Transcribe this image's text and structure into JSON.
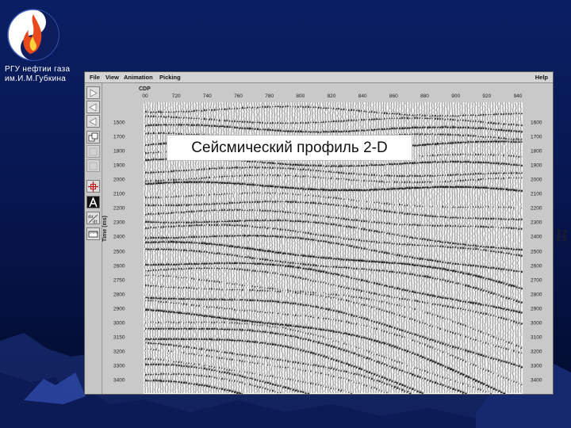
{
  "slide": {
    "org_line1": "РГУ нефтии газа",
    "org_line2": "им.И.М.Губкина",
    "title": "Сейсмический профиль 2-D",
    "colors": {
      "background_top": "#0a1f63",
      "background_bottom": "#020a28",
      "logo_flame": "#e8491d",
      "logo_bg": "#ffffff"
    }
  },
  "window": {
    "menu": {
      "file": "File",
      "view": "View",
      "animation": "Animation",
      "picking": "Picking",
      "help": "Help"
    },
    "tools": [
      {
        "icon": "play-forward-icon"
      },
      {
        "icon": "step-back-icon"
      },
      {
        "icon": "step-back-icon"
      },
      {
        "icon": "duplicate-window-icon"
      },
      {
        "icon": "disabled-tool-icon"
      },
      {
        "icon": "disabled-tool-icon"
      },
      {
        "icon": "zoom-crosshair-icon"
      },
      {
        "icon": "annotation-A-icon"
      },
      {
        "icon": "dx-dt-icon"
      },
      {
        "icon": "ruler-icon"
      }
    ],
    "plot": {
      "x_axis_label": "CDP",
      "y_axis_label": "Time (ms)",
      "x_ticks": [
        "00",
        "720",
        "740",
        "760",
        "780",
        "800",
        "820",
        "840",
        "860",
        "880",
        "900",
        "920",
        "940"
      ],
      "y_ticks_left": [
        "1500",
        "1700",
        "1800",
        "1900",
        "2000",
        "2100",
        "2200",
        "2300",
        "2400",
        "2500",
        "2600",
        "2750",
        "2800",
        "2900",
        "3000",
        "3150",
        "3200",
        "3300",
        "3400"
      ],
      "y_ticks_right": [
        "1600",
        "1700",
        "1800",
        "1900",
        "2000",
        "2100",
        "2200",
        "2300",
        "2400",
        "2500",
        "2600",
        "2700",
        "2800",
        "2900",
        "3000",
        "3100",
        "3200",
        "3300",
        "3400"
      ]
    }
  }
}
